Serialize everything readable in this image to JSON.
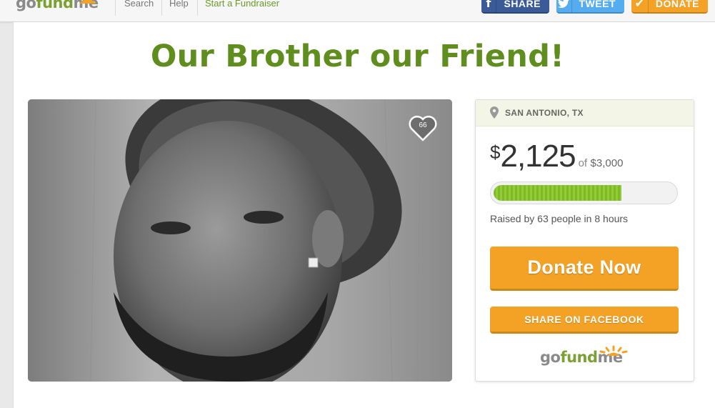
{
  "nav": {
    "logo": {
      "go": "go",
      "fund": "fund",
      "me": "me"
    },
    "links": [
      "Search",
      "Help",
      "Start a Fundraiser"
    ],
    "share_label": "SHARE",
    "tweet_label": "TWEET",
    "donate_label": "DONATE"
  },
  "campaign": {
    "title": "Our Brother our Friend!",
    "likes": "66",
    "location": "SAN ANTONIO, TX",
    "currency": "$",
    "raised": "2,125",
    "of_label": "of",
    "goal": "$3,000",
    "progress_fraction": 0.708,
    "raised_by": {
      "prefix": "Raised by",
      "people": "63",
      "middle": "people in",
      "hours": "8",
      "suffix": "hours"
    },
    "donate_now_label": "Donate Now",
    "share_facebook_label": "SHARE ON FACEBOOK"
  },
  "colors": {
    "brand_green": "#5f8d1e",
    "orange": "#f3a226",
    "facebook": "#3b5a98",
    "twitter": "#55acee",
    "progress": "#7dba24"
  },
  "icons": {
    "share": "facebook-icon",
    "tweet": "twitter-bird-icon",
    "donate": "checkmark-icon",
    "location": "map-pin-icon",
    "like": "heart-icon"
  }
}
